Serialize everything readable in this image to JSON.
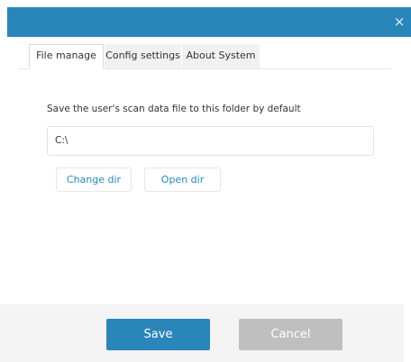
{
  "dialog": {
    "close_glyph": "×",
    "accent_color": "#2a86ba"
  },
  "tabs": [
    {
      "label": "File manage",
      "active": true
    },
    {
      "label": "Config settings",
      "active": false
    },
    {
      "label": "About System",
      "active": false
    }
  ],
  "file_manage": {
    "description": "Save the user's scan data file to this folder by default",
    "path_value": "C:\\",
    "change_dir_label": "Change dir",
    "open_dir_label": "Open dir"
  },
  "footer": {
    "save_label": "Save",
    "cancel_label": "Cancel"
  }
}
